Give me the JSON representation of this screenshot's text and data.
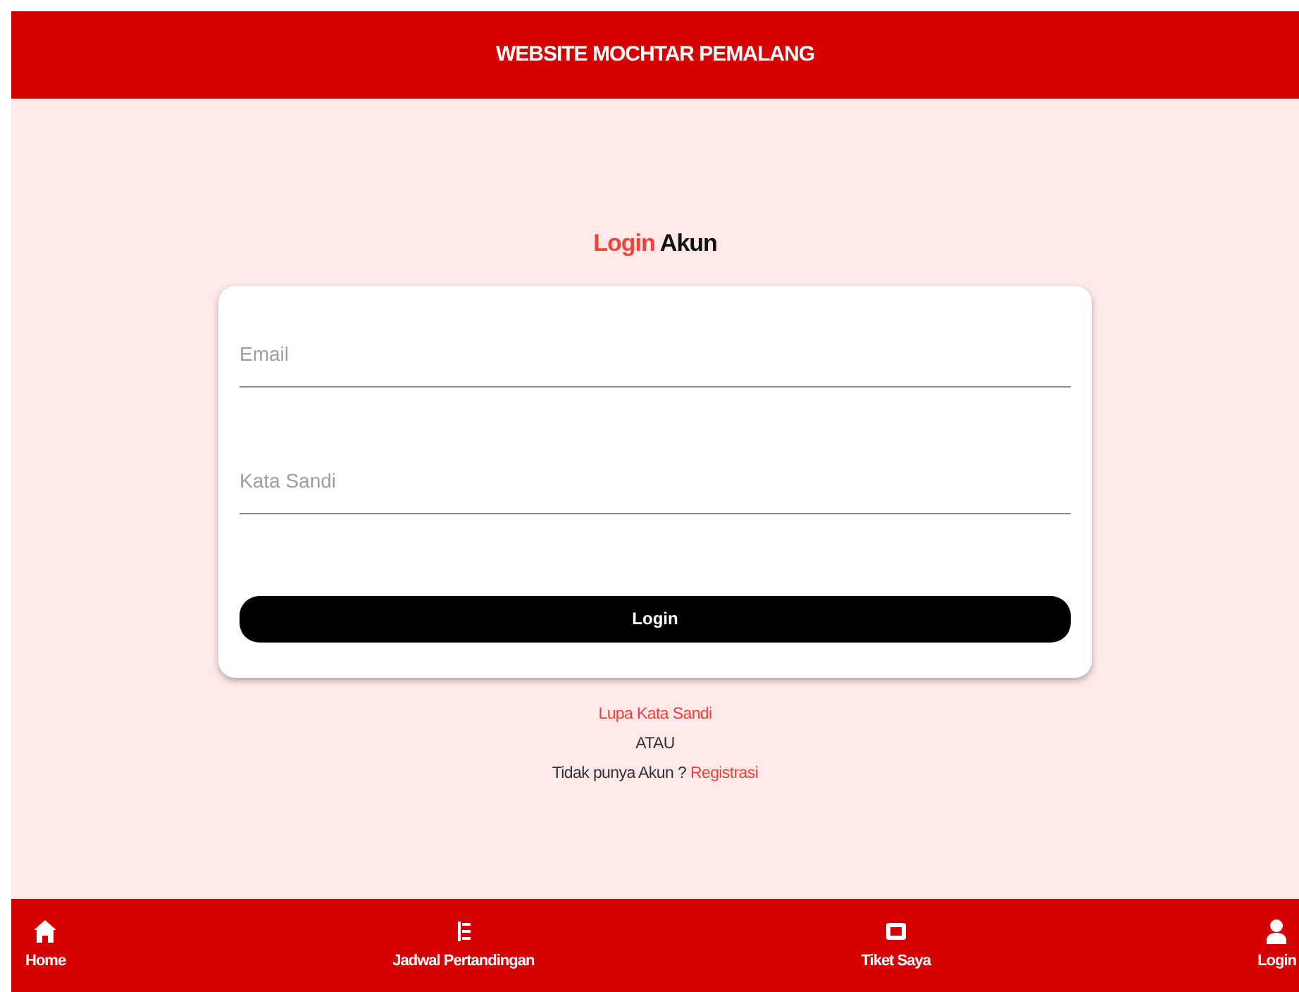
{
  "header": {
    "title": "WEBSITE MOCHTAR PEMALANG"
  },
  "heading": {
    "accent": "Login",
    "rest": "Akun"
  },
  "form": {
    "fields": [
      {
        "placeholder": "Email"
      },
      {
        "placeholder": "Kata Sandi"
      }
    ],
    "submit": "Login"
  },
  "links": {
    "forgot": "Lupa Kata Sandi",
    "separator": "ATAU",
    "register_prompt": "Tidak punya Akun ?",
    "register": "Registrasi"
  },
  "bottom_nav": [
    {
      "label": "Home",
      "kind": "home"
    },
    {
      "label": "Jadwal Pertandingan",
      "kind": "list"
    },
    {
      "label": "Tiket Saya",
      "kind": "ticket"
    },
    {
      "label": "Login",
      "kind": "user"
    }
  ]
}
